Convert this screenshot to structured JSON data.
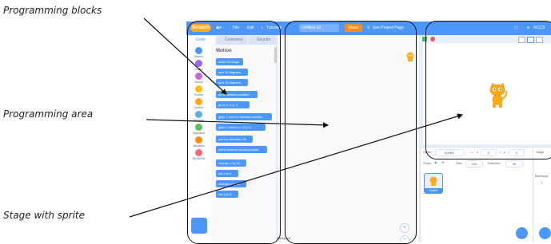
{
  "annotations": {
    "blocks_label": "Programming blocks",
    "area_label": "Programming area",
    "stage_label": "Stage with sprite"
  },
  "menubar": {
    "logo": "Scratch",
    "file": "File",
    "edit": "Edit",
    "tutorials": "Tutorials",
    "project_title": "Untitled-10",
    "share": "Share",
    "see_project_page": "See Project Page",
    "user": "NCCS"
  },
  "tabs": {
    "code": "Code",
    "costumes": "Costumes",
    "sounds": "Sounds"
  },
  "categories": [
    {
      "label": "Motion",
      "color": "#4c97ff"
    },
    {
      "label": "Looks",
      "color": "#9966ff"
    },
    {
      "label": "Sound",
      "color": "#cf63cf"
    },
    {
      "label": "Events",
      "color": "#ffbf00"
    },
    {
      "label": "Control",
      "color": "#ffab19"
    },
    {
      "label": "Sensing",
      "color": "#5cb1d6"
    },
    {
      "label": "Operators",
      "color": "#59c059"
    },
    {
      "label": "Variables",
      "color": "#ff8c1a"
    },
    {
      "label": "My Blocks",
      "color": "#ff6680"
    }
  ],
  "palette": {
    "title": "Motion",
    "blocks": {
      "move": "move 10 steps",
      "turn_right": "turn 15 degrees",
      "turn_left": "turn 15 degrees",
      "goto_random": "go to random position",
      "goto_xy": "go to x: 0 y: 0",
      "glide_random": "glide 1 secs to random position",
      "glide_xy": "glide 1 secs to x: 0 y: 0",
      "point_dir": "point in direction 90",
      "point_towards": "point towards mouse-pointer",
      "change_x": "change x by 10",
      "set_x": "set x to 0",
      "change_y": "change y by 10",
      "set_y": "set y to 0"
    }
  },
  "code_area": {
    "backpack": "Backpack",
    "zoom_in": "+",
    "zoom_out": "−"
  },
  "sprite_info": {
    "sprite_label": "Sprite",
    "sprite_name": "Sprite1",
    "x_label": "x",
    "x_value": "0",
    "y_label": "y",
    "y_value": "0",
    "show_label": "Show",
    "size_label": "Size",
    "size_value": "100",
    "direction_label": "Direction",
    "direction_value": "90",
    "tile_name": "Sprite1"
  },
  "stage_panel": {
    "title": "Stage",
    "backdrops_label": "Backdrops",
    "backdrops_count": "1"
  }
}
